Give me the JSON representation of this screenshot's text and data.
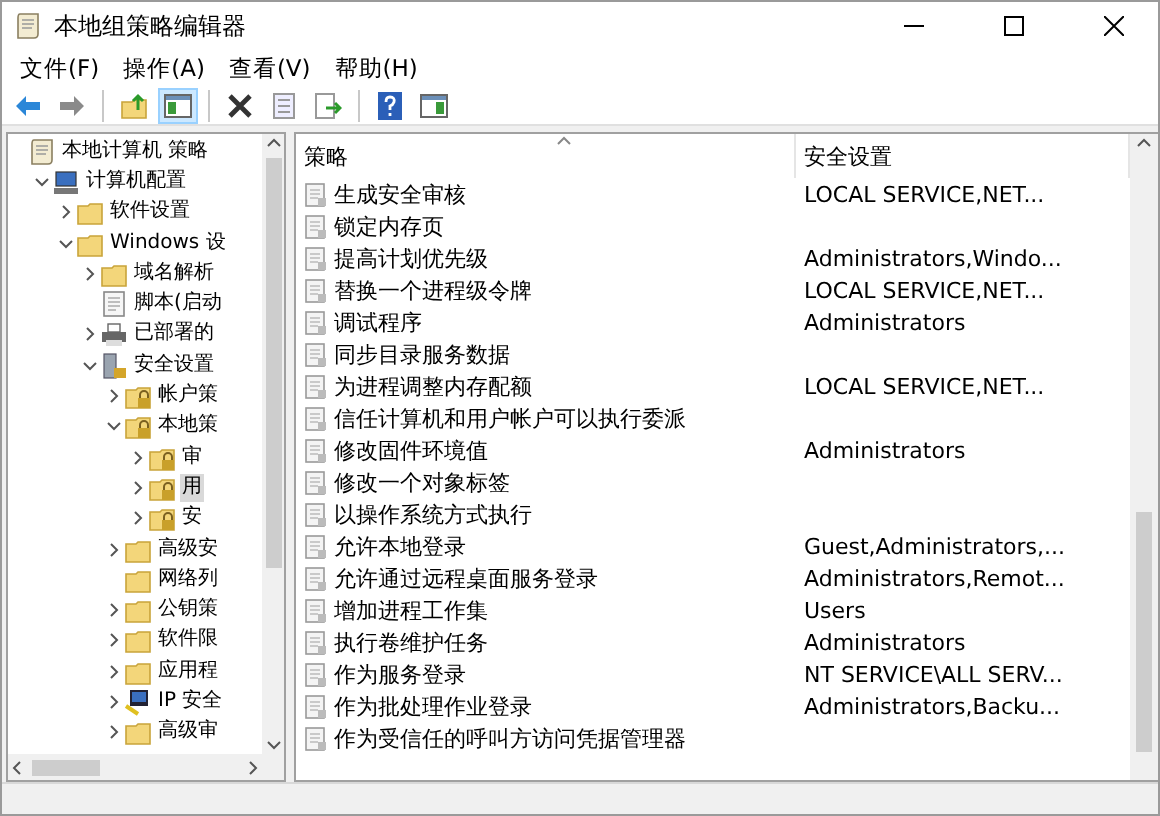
{
  "window": {
    "title": "本地组策略编辑器"
  },
  "menu": [
    "文件(F)",
    "操作(A)",
    "查看(V)",
    "帮助(H)"
  ],
  "toolbar": [
    {
      "kind": "back",
      "selected": false
    },
    {
      "kind": "forward",
      "selected": false
    },
    {
      "kind": "sep"
    },
    {
      "kind": "up",
      "selected": false
    },
    {
      "kind": "tree",
      "selected": true
    },
    {
      "kind": "sep"
    },
    {
      "kind": "delete",
      "selected": false
    },
    {
      "kind": "properties",
      "selected": false
    },
    {
      "kind": "export",
      "selected": false
    },
    {
      "kind": "sep"
    },
    {
      "kind": "help",
      "selected": false
    },
    {
      "kind": "pane",
      "selected": false
    }
  ],
  "tree": [
    {
      "label": "本地计算机 策略",
      "kind": "scroll",
      "selected": false,
      "children": [
        {
          "label": "计算机配置",
          "kind": "computer",
          "expanded": true,
          "selected": false,
          "children": [
            {
              "label": "软件设置",
              "kind": "folder",
              "expanded": false,
              "selected": false
            },
            {
              "label": "Windows 设",
              "kind": "folder",
              "expanded": true,
              "selected": false,
              "children": [
                {
                  "label": "域名解析",
                  "kind": "folder",
                  "expanded": false,
                  "selected": false
                },
                {
                  "label": "脚本(启动",
                  "kind": "script",
                  "selected": false
                },
                {
                  "label": "已部署的",
                  "kind": "printer",
                  "expanded": false,
                  "selected": false
                },
                {
                  "label": "安全设置",
                  "kind": "server",
                  "expanded": true,
                  "selected": false,
                  "children": [
                    {
                      "label": "帐户策",
                      "kind": "lockfolder",
                      "expanded": false,
                      "selected": false
                    },
                    {
                      "label": "本地策",
                      "kind": "lockfolder",
                      "expanded": true,
                      "selected": false,
                      "children": [
                        {
                          "label": "审",
                          "kind": "lockfolder",
                          "expanded": false,
                          "selected": false
                        },
                        {
                          "label": "用",
                          "kind": "lockfolder",
                          "expanded": false,
                          "selected": true
                        },
                        {
                          "label": "安",
                          "kind": "lockfolder",
                          "expanded": false,
                          "selected": false
                        }
                      ]
                    },
                    {
                      "label": "高级安",
                      "kind": "folder",
                      "expanded": false,
                      "selected": false
                    },
                    {
                      "label": "网络列",
                      "kind": "folder",
                      "selected": false
                    },
                    {
                      "label": "公钥策",
                      "kind": "folder",
                      "expanded": false,
                      "selected": false
                    },
                    {
                      "label": "软件限",
                      "kind": "folder",
                      "expanded": false,
                      "selected": false
                    },
                    {
                      "label": "应用程",
                      "kind": "folder",
                      "expanded": false,
                      "selected": false
                    },
                    {
                      "label": "IP 安全",
                      "kind": "ip",
                      "expanded": false,
                      "selected": false
                    },
                    {
                      "label": "高级审",
                      "kind": "folder",
                      "expanded": false,
                      "selected": false
                    }
                  ]
                }
              ]
            }
          ]
        }
      ]
    }
  ],
  "table": {
    "columns": [
      "策略",
      "安全设置"
    ],
    "rows": [
      {
        "policy": "生成安全审核",
        "setting": "LOCAL SERVICE,NET..."
      },
      {
        "policy": "锁定内存页"
      },
      {
        "policy": "提高计划优先级",
        "setting": "Administrators,Windo..."
      },
      {
        "policy": "替换一个进程级令牌",
        "setting": "LOCAL SERVICE,NET..."
      },
      {
        "policy": "调试程序",
        "setting": "Administrators"
      },
      {
        "policy": "同步目录服务数据"
      },
      {
        "policy": "为进程调整内存配额",
        "setting": "LOCAL SERVICE,NET..."
      },
      {
        "policy": "信任计算机和用户帐户可以执行委派"
      },
      {
        "policy": "修改固件环境值",
        "setting": "Administrators"
      },
      {
        "policy": "修改一个对象标签"
      },
      {
        "policy": "以操作系统方式执行"
      },
      {
        "policy": "允许本地登录",
        "setting": "Guest,Administrators,..."
      },
      {
        "policy": "允许通过远程桌面服务登录",
        "setting": "Administrators,Remot..."
      },
      {
        "policy": "增加进程工作集",
        "setting": "Users"
      },
      {
        "policy": "执行卷维护任务",
        "setting": "Administrators"
      },
      {
        "policy": "作为服务登录",
        "setting": "NT SERVICE\\ALL SERV..."
      },
      {
        "policy": "作为批处理作业登录",
        "setting": "Administrators,Backu..."
      },
      {
        "policy": "作为受信任的呼叫方访问凭据管理器"
      }
    ]
  }
}
